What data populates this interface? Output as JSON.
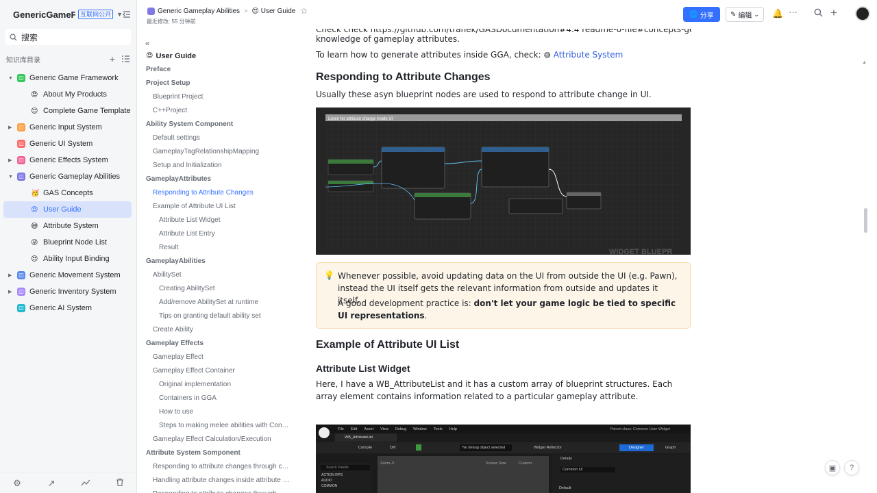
{
  "colors": {
    "accent": "#3370ff",
    "active_bg": "#d9e2fb",
    "callout_bg": "#fef5e9"
  },
  "sidebar": {
    "title": "GenericGameFra...",
    "badge": "互联网公开",
    "search_placeholder": "搜索",
    "section_label": "知识库目录",
    "items": [
      {
        "label": "Generic Game Framework",
        "level": 1,
        "expanded": true,
        "icon": "green-doc-icon"
      },
      {
        "label": "About My Products",
        "level": 2,
        "icon": "heart-eyes-emoji"
      },
      {
        "label": "Complete Game Template",
        "level": 2,
        "icon": "smile-emoji"
      },
      {
        "label": "Generic Input System",
        "level": 1,
        "expanded": false,
        "icon": "orange-doc-icon"
      },
      {
        "label": "Generic UI System",
        "level": 1,
        "icon": "red-doc-icon"
      },
      {
        "label": "Generic Effects System",
        "level": 1,
        "expanded": false,
        "icon": "pink-doc-icon"
      },
      {
        "label": "Generic Gameplay Abilities",
        "level": 1,
        "expanded": true,
        "icon": "purple-doc-icon"
      },
      {
        "label": "GAS Concepts",
        "level": 2,
        "icon": "party-emoji"
      },
      {
        "label": "User Guide",
        "level": 2,
        "active": true,
        "icon": "heart-eyes-emoji"
      },
      {
        "label": "Attribute System",
        "level": 2,
        "icon": "sweat-smile-emoji"
      },
      {
        "label": "Blueprint Node List",
        "level": 2,
        "icon": "wink-emoji"
      },
      {
        "label": "Ability Input Binding",
        "level": 2,
        "icon": "heart-eyes-emoji"
      },
      {
        "label": "Generic Movement System",
        "level": 1,
        "expanded": false,
        "icon": "blue-doc-icon"
      },
      {
        "label": "Generic Inventory System",
        "level": 1,
        "expanded": false,
        "icon": "violet-doc-icon"
      },
      {
        "label": "Generic AI System",
        "level": 1,
        "icon": "teal-doc-icon"
      }
    ]
  },
  "topbar": {
    "crumb_parent": "Generic Gameplay Abilities",
    "crumb_current": "User Guide",
    "modified": "最近修改: 55 分钟前",
    "share_label": "分享",
    "edit_label": "编辑"
  },
  "outline": {
    "items": [
      {
        "label": "User Guide",
        "type": "title"
      },
      {
        "label": "Preface",
        "type": "h1"
      },
      {
        "label": "Project Setup",
        "type": "h1"
      },
      {
        "label": "Blueprint Project",
        "type": "h2"
      },
      {
        "label": "C++Project",
        "type": "h2"
      },
      {
        "label": "Ability System Component",
        "type": "h1"
      },
      {
        "label": "Default settings",
        "type": "h2"
      },
      {
        "label": "GameplayTagRelationshipMapping",
        "type": "h2"
      },
      {
        "label": "Setup and Initialization",
        "type": "h2"
      },
      {
        "label": "GameplayAttributes",
        "type": "h1"
      },
      {
        "label": "Responding to Attribute Changes",
        "type": "h2",
        "active": true
      },
      {
        "label": "Example of Attribute UI List",
        "type": "h2"
      },
      {
        "label": "Attribute List Widget",
        "type": "h3"
      },
      {
        "label": "Attribute List Entry",
        "type": "h3"
      },
      {
        "label": "Result",
        "type": "h3"
      },
      {
        "label": "GameplayAbilities",
        "type": "h1"
      },
      {
        "label": "AbilitySet",
        "type": "h2"
      },
      {
        "label": "Creating AbilitySet",
        "type": "h3"
      },
      {
        "label": "Add/remove AbilitySet at runtime",
        "type": "h3"
      },
      {
        "label": "Tips on granting default ability set",
        "type": "h3"
      },
      {
        "label": "Create Ability",
        "type": "h2"
      },
      {
        "label": "Gameplay Effects",
        "type": "h1"
      },
      {
        "label": "Gameplay Effect",
        "type": "h2"
      },
      {
        "label": "Gameplay Effect Container",
        "type": "h2"
      },
      {
        "label": "Original implementation",
        "type": "h3"
      },
      {
        "label": "Containers in GGA",
        "type": "h3"
      },
      {
        "label": "How to use",
        "type": "h3"
      },
      {
        "label": "Steps to making melee abilities with Contai...",
        "type": "h3"
      },
      {
        "label": "Gameplay Effect Calculation/Execution",
        "type": "h2"
      },
      {
        "label": "Attribute System Somponent",
        "type": "h1"
      },
      {
        "label": "Responding to attribute changes through co...",
        "type": "h2"
      },
      {
        "label": "Handling attribute changes inside attribute sy...",
        "type": "h2"
      },
      {
        "label": "Responding to attribute changes through ...",
        "type": "h2"
      }
    ]
  },
  "content": {
    "intro_partial": "Check check https://github.com/tranek/GASDocumentation#4.4 readme-0-file#concepts-ge for the basic",
    "intro_line2": "knowledge of gameplay attributes.",
    "learn_prefix": "To learn how to generate attributes inside GGA, check:",
    "learn_link": "Attribute System",
    "h_responding": "Responding to Attribute Changes",
    "p_responding": "Usually these asyn blueprint nodes are used to respond to attribute change in UI.",
    "bp_image": {
      "header": "Listen for attribute change inside UI",
      "watermark": "WIDGET BLUEPR",
      "node_set_owning": "Get Owning Player Pawn",
      "node_listen1": "Listen for Attribute Change",
      "node_listen2": "Listen for Attributes Change",
      "node_make": "Make Array",
      "node_branch": "Branch"
    },
    "callout_p1": "Whenever possible, avoid updating data on the UI from outside the UI (e.g. Pawn), instead the UI itself gets the relevant information from outside and updates it itself.",
    "callout_p2_prefix": "A good development practice is: ",
    "callout_p2_bold": "don't let your game logic be tied to specific UI representations",
    "callout_p2_suffix": ".",
    "h_example": "Example of Attribute UI List",
    "h_widget": "Attribute List Widget",
    "p_widget": "Here, I have a WB_AttributeList and it has a custom array of blueprint structures. Each array element contains information related to a particular gameplay attribute.",
    "ue_image": {
      "menu": [
        "File",
        "Edit",
        "Asset",
        "View",
        "Debug",
        "Window",
        "Tools",
        "Help"
      ],
      "tab": "WB_AttributeList",
      "parent_class": "Parent class: Common User Widget",
      "compile": "Compile",
      "diff": "Diff",
      "debug_select": "No debug object selected",
      "widget_reflector": "Widget Reflector",
      "designer": "Designer",
      "graph": "Graph",
      "details": "Details",
      "common_ui": "Common UI",
      "search_palette": "Search Palette",
      "palette_items": [
        "ACTION RPG",
        "AUDIO",
        "COMMON"
      ],
      "zoom": "Zoom -5",
      "screen_size": "Screen Size",
      "custom": "Custom",
      "default": "Default"
    }
  }
}
